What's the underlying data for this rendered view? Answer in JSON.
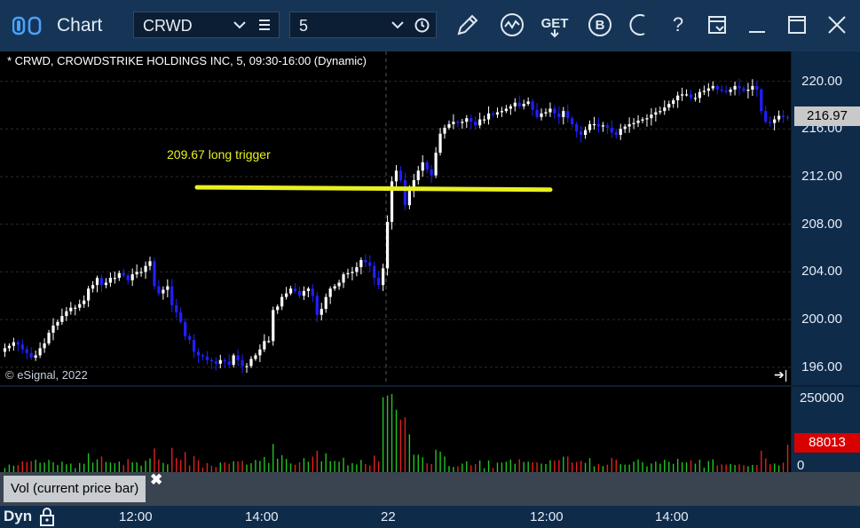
{
  "window": {
    "title": "Chart"
  },
  "toolbar": {
    "symbol": "CRWD",
    "interval": "5",
    "get_label": "GET",
    "b_label": "B",
    "help_label": "?"
  },
  "chart": {
    "header": "* CRWD, CROWDSTRIKE HOLDINGS INC, 5, 09:30-16:00 (Dynamic)",
    "copyright": "© eSignal, 2022",
    "annotation": "209.67 long trigger",
    "last_price": "216.97",
    "last_volume": "88013",
    "volume_study": "Vol (current price bar)",
    "time_mode": "Dyn",
    "x_labels": [
      "12:00",
      "14:00",
      "22",
      "12:00",
      "14:00"
    ],
    "y_labels": [
      "220.00",
      "216.00",
      "212.00",
      "208.00",
      "204.00",
      "200.00",
      "196.00"
    ],
    "vol_labels": [
      "250000",
      "0"
    ],
    "colors": {
      "up": "#ffffff",
      "down": "#2020ff",
      "trigger_line": "#e8f020",
      "vol_up": "#22c422",
      "vol_down": "#e02020"
    }
  },
  "chart_data": {
    "type": "candlestick",
    "title": "* CRWD, CROWDSTRIKE HOLDINGS INC, 5, 09:30-16:00 (Dynamic)",
    "ylim": [
      194.5,
      222.5
    ],
    "annotation": {
      "text": "209.67 long trigger",
      "level": 211.0
    },
    "closes": [
      197.6,
      197.8,
      198.1,
      197.9,
      197.5,
      197.2,
      196.8,
      197.0,
      197.6,
      198.0,
      198.9,
      199.5,
      199.8,
      200.3,
      200.7,
      201.0,
      201.0,
      201.3,
      201.6,
      202.6,
      202.9,
      203.5,
      202.9,
      203.1,
      203.5,
      203.5,
      203.9,
      203.7,
      203.3,
      203.8,
      204.0,
      204.0,
      204.5,
      204.9,
      202.8,
      202.2,
      202.5,
      202.8,
      201.2,
      200.6,
      199.8,
      198.6,
      198.3,
      197.3,
      197.0,
      196.9,
      196.6,
      196.5,
      196.3,
      196.6,
      196.5,
      196.2,
      197.0,
      196.6,
      196.1,
      196.1,
      196.7,
      197.0,
      197.5,
      198.2,
      198.2,
      200.8,
      201.1,
      201.9,
      202.2,
      202.6,
      202.4,
      202.0,
      202.4,
      202.6,
      202.0,
      200.4,
      200.9,
      201.9,
      202.6,
      202.8,
      203.1,
      203.8,
      203.9,
      204.0,
      204.4,
      205.0,
      204.8,
      204.5,
      203.5,
      202.9,
      204.3,
      208.2,
      211.6,
      212.5,
      211.7,
      209.6,
      210.8,
      211.7,
      212.5,
      213.2,
      212.6,
      212.1,
      214.0,
      215.6,
      216.1,
      216.4,
      216.6,
      216.5,
      216.6,
      216.9,
      216.6,
      216.3,
      216.8,
      216.8,
      217.3,
      217.2,
      217.4,
      217.5,
      217.7,
      217.9,
      218.2,
      217.9,
      218.1,
      218.3,
      217.6,
      217.0,
      217.3,
      217.4,
      217.7,
      217.3,
      217.0,
      217.5,
      216.9,
      216.4,
      215.8,
      215.5,
      215.9,
      216.4,
      216.4,
      216.2,
      216.3,
      216.1,
      215.7,
      215.5,
      216.0,
      216.2,
      216.4,
      216.5,
      216.7,
      216.8,
      216.9,
      217.2,
      217.4,
      217.5,
      217.8,
      218.1,
      218.4,
      218.8,
      218.9,
      218.9,
      218.6,
      218.6,
      219.1,
      219.2,
      219.4,
      219.6,
      219.3,
      219.2,
      219.1,
      219.3,
      219.6,
      219.4,
      219.2,
      219.3,
      219.6,
      219.3,
      217.5,
      216.6,
      216.5,
      216.8,
      217.1,
      217.0,
      216.97
    ],
    "volume_ylim": [
      0,
      250000
    ],
    "last_volume": 88013
  }
}
